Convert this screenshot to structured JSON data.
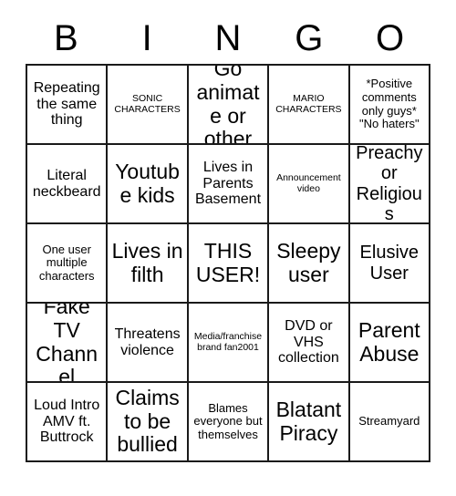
{
  "card": {
    "header_letters": [
      "B",
      "I",
      "N",
      "G",
      "O"
    ],
    "rows": [
      [
        {
          "text": "Repeating the same thing",
          "size": "sz-md"
        },
        {
          "text": "SONIC CHARACTERS",
          "size": "sz-xs"
        },
        {
          "text": "Go animate or other",
          "size": "sz-xl"
        },
        {
          "text": "MARIO CHARACTERS",
          "size": "sz-xs"
        },
        {
          "text": "*Positive comments only guys* \"No haters\"",
          "size": "sz-sm"
        }
      ],
      [
        {
          "text": "Literal neckbeard",
          "size": "sz-md"
        },
        {
          "text": "Youtube kids",
          "size": "sz-xl"
        },
        {
          "text": "Lives in Parents Basement",
          "size": "sz-md"
        },
        {
          "text": "Announcement video",
          "size": "sz-xs"
        },
        {
          "text": "Preachy or Religious",
          "size": "sz-lg"
        }
      ],
      [
        {
          "text": "One user multiple characters",
          "size": "sz-sm"
        },
        {
          "text": "Lives in filth",
          "size": "sz-xl"
        },
        {
          "text": "THIS USER!",
          "size": "sz-xl"
        },
        {
          "text": "Sleepy user",
          "size": "sz-xl"
        },
        {
          "text": "Elusive User",
          "size": "sz-lg"
        }
      ],
      [
        {
          "text": "Fake TV Channel",
          "size": "sz-xl"
        },
        {
          "text": "Threatens violence",
          "size": "sz-md"
        },
        {
          "text": "Media/franchise brand fan2001",
          "size": "sz-xs"
        },
        {
          "text": "DVD or VHS collection",
          "size": "sz-md"
        },
        {
          "text": "Parent Abuse",
          "size": "sz-xl"
        }
      ],
      [
        {
          "text": "Loud Intro AMV ft. Buttrock",
          "size": "sz-md"
        },
        {
          "text": "Claims to be bullied",
          "size": "sz-xl"
        },
        {
          "text": "Blames everyone but themselves",
          "size": "sz-sm"
        },
        {
          "text": "Blatant Piracy",
          "size": "sz-xl"
        },
        {
          "text": "Streamyard",
          "size": "sz-sm"
        }
      ]
    ]
  },
  "colors": {
    "background": "#ffffff",
    "grid_line": "#1a1a1a",
    "text": "#000000"
  }
}
